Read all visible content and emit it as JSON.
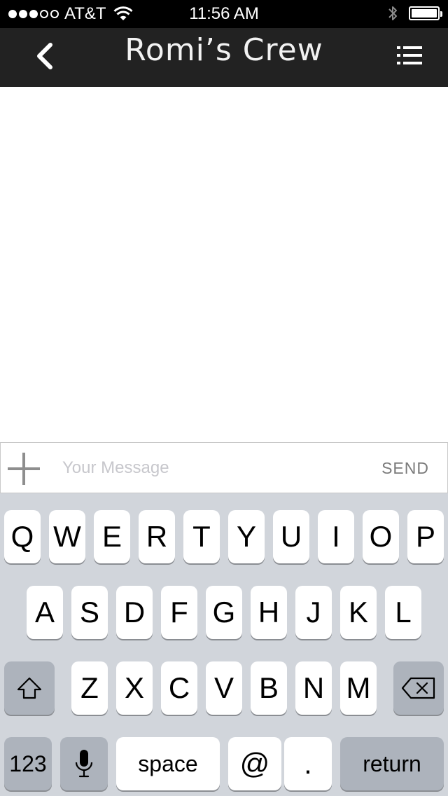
{
  "status_bar": {
    "carrier": "AT&T",
    "time": "11:56 AM",
    "signal_full": 3,
    "signal_total": 5
  },
  "nav": {
    "title": "Romi’s Crew",
    "back_icon": "chevron-left-icon",
    "menu_icon": "list-icon"
  },
  "composer": {
    "placeholder": "Your Message",
    "send_label": "SEND",
    "add_icon": "plus-icon"
  },
  "keyboard": {
    "row1": [
      "Q",
      "W",
      "E",
      "R",
      "T",
      "Y",
      "U",
      "I",
      "O",
      "P"
    ],
    "row2": [
      "A",
      "S",
      "D",
      "F",
      "G",
      "H",
      "J",
      "K",
      "L"
    ],
    "row3": [
      "Z",
      "X",
      "C",
      "V",
      "B",
      "N",
      "M"
    ],
    "numbers_label": "123",
    "space_label": "space",
    "at_label": "@",
    "period_label": ".",
    "return_label": "return"
  },
  "colors": {
    "nav_background": "#222222",
    "keyboard_background": "#d1d5db"
  }
}
